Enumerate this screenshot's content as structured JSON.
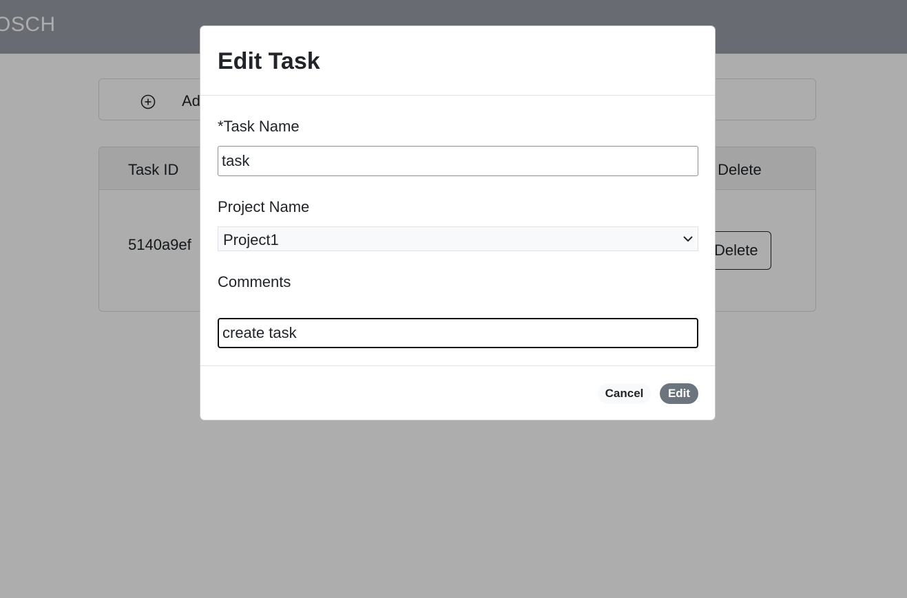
{
  "navbar": {
    "brand": "OSCH"
  },
  "add_bar": {
    "label": "Ad",
    "icon": "plus-circle-icon"
  },
  "table": {
    "headers": {
      "task_id": "Task ID",
      "task_delete": "sk Delete"
    },
    "rows": [
      {
        "task_id": "5140a9ef",
        "delete_label": "Delete"
      }
    ]
  },
  "modal": {
    "title": "Edit Task",
    "task_name_label": "*Task Name",
    "task_name_value": "task",
    "project_name_label": "Project Name",
    "project_selected": "Project1",
    "comments_label": "Comments",
    "comments_value": "create task",
    "cancel_label": "Cancel",
    "edit_label": "Edit"
  },
  "colors": {
    "navbar": "#9aa0a9",
    "edit_button": "#6c757d",
    "backdrop": "rgba(0,0,0,0.32)"
  }
}
